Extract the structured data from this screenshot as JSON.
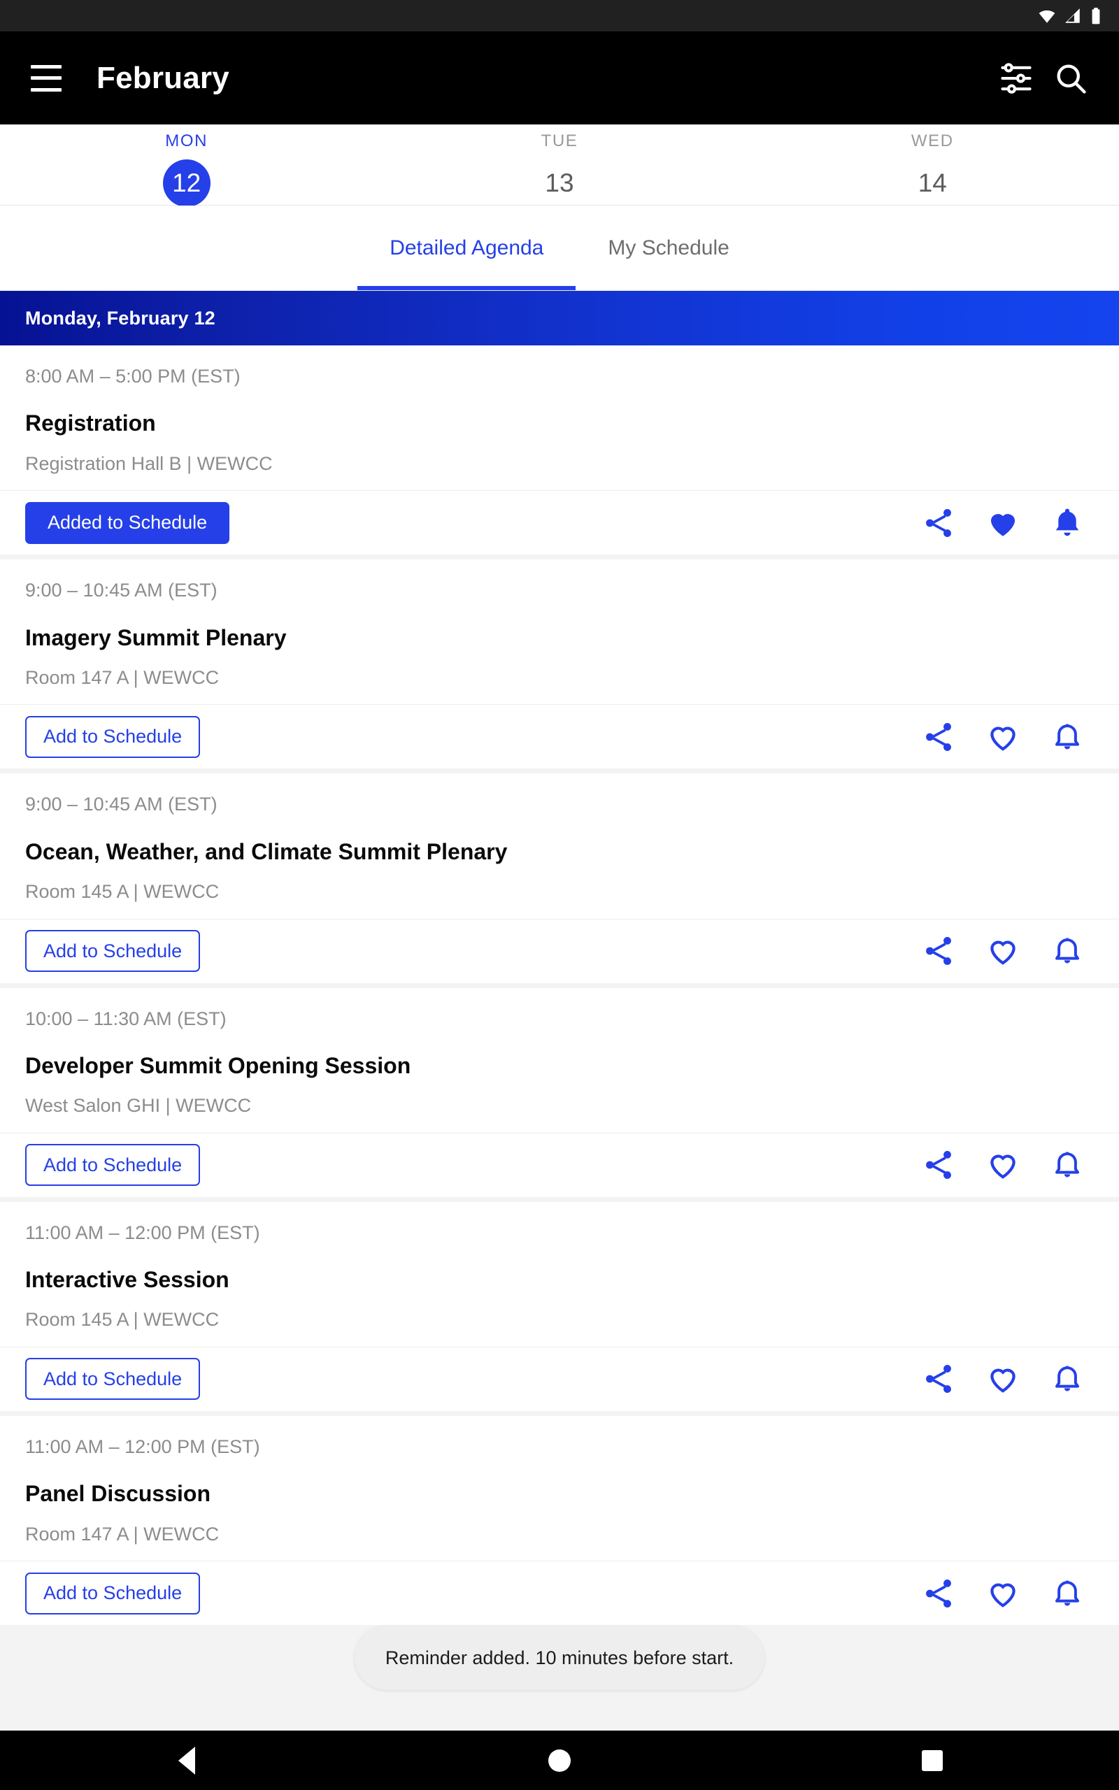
{
  "status_bar": {
    "icons": [
      "wifi-icon",
      "cellular-signal-icon",
      "battery-icon"
    ]
  },
  "app_bar": {
    "menu_icon": "hamburger-menu-icon",
    "title": "February",
    "filter_icon": "tune-filter-icon",
    "search_icon": "search-icon"
  },
  "date_strip": {
    "days": [
      {
        "dow": "MON",
        "num": "12",
        "selected": true
      },
      {
        "dow": "TUE",
        "num": "13",
        "selected": false
      },
      {
        "dow": "WED",
        "num": "14",
        "selected": false
      }
    ]
  },
  "tabs": [
    {
      "label": "Detailed Agenda",
      "active": true
    },
    {
      "label": "My Schedule",
      "active": false
    }
  ],
  "day_banner": {
    "text": "Monday, February 12"
  },
  "events": [
    {
      "time": "8:00 AM – 5:00 PM (EST)",
      "title": "Registration",
      "location": "Registration Hall B | WEWCC",
      "button_label": "Added to Schedule",
      "button_state": "added",
      "share_icon": "share-icon",
      "favorite_icon": "heart-filled-icon",
      "reminder_icon": "bell-filled-icon"
    },
    {
      "time": "9:00 – 10:45 AM (EST)",
      "title": "Imagery Summit Plenary",
      "location": "Room 147 A | WEWCC",
      "button_label": "Add to Schedule",
      "button_state": "not-added",
      "share_icon": "share-icon",
      "favorite_icon": "heart-outline-icon",
      "reminder_icon": "bell-outline-icon"
    },
    {
      "time": "9:00 – 10:45 AM (EST)",
      "title": "Ocean, Weather, and Climate Summit Plenary",
      "location": "Room 145 A | WEWCC",
      "button_label": "Add to Schedule",
      "button_state": "not-added",
      "share_icon": "share-icon",
      "favorite_icon": "heart-outline-icon",
      "reminder_icon": "bell-outline-icon"
    },
    {
      "time": "10:00 – 11:30 AM (EST)",
      "title": "Developer Summit Opening Session",
      "location": "West Salon GHI | WEWCC",
      "button_label": "Add to Schedule",
      "button_state": "not-added",
      "share_icon": "share-icon",
      "favorite_icon": "heart-outline-icon",
      "reminder_icon": "bell-outline-icon"
    },
    {
      "time": "11:00 AM – 12:00 PM (EST)",
      "title": "Interactive Session",
      "location": "Room 145 A | WEWCC",
      "button_label": "Add to Schedule",
      "button_state": "not-added",
      "share_icon": "share-icon",
      "favorite_icon": "heart-outline-icon",
      "reminder_icon": "bell-outline-icon"
    },
    {
      "time": "11:00 AM – 12:00 PM (EST)",
      "title": "Panel Discussion",
      "location": "Room 147 A | WEWCC",
      "button_label": "Add to Schedule",
      "button_state": "not-added",
      "share_icon": "share-icon",
      "favorite_icon": "heart-outline-icon",
      "reminder_icon": "bell-outline-icon"
    }
  ],
  "toast": {
    "message": "Reminder added. 10 minutes before start."
  },
  "nav_bar": {
    "back_icon": "back-triangle-icon",
    "home_icon": "home-circle-icon",
    "recents_icon": "recents-square-icon"
  },
  "colors": {
    "accent_blue": "#2540E8",
    "banner_blue_dark": "#061293",
    "banner_blue_light": "#1544EE",
    "app_bar_black": "#000000",
    "status_bar": "#212121",
    "toast_bg": "#EEEEEE",
    "muted_text": "#8C8C8C"
  }
}
